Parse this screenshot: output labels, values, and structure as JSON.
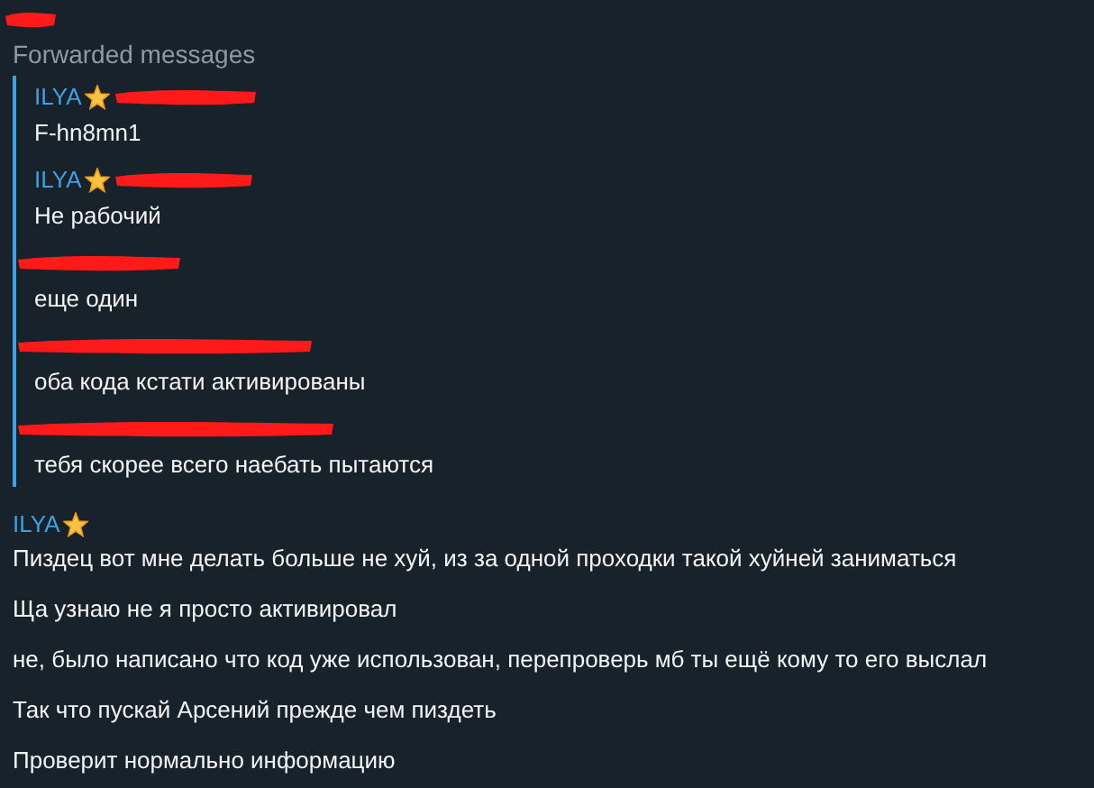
{
  "forwarded": {
    "label": "Forwarded messages",
    "messages": [
      {
        "sender": "ILYA",
        "text": "F-hn8mn1"
      },
      {
        "sender": "ILYA",
        "text": "Не рабочий"
      },
      {
        "text": "еще один"
      },
      {
        "text": "оба кода кстати активированы"
      },
      {
        "text": "тебя скорее всего наебать пытаются"
      }
    ]
  },
  "reply": {
    "sender": "ILYA",
    "messages": [
      "Пиздец вот мне делать больше не хуй, из за одной проходки такой хуйней заниматься",
      "Ща узнаю не я просто активировал",
      "не, было написано что код уже использован, перепроверь мб ты ещё кому то его выслал",
      "Так что пускай Арсений прежде чем пиздеть",
      "Проверит нормально информацию"
    ]
  }
}
